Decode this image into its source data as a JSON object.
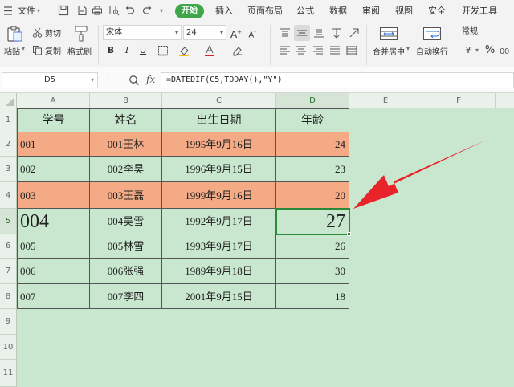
{
  "menubar": {
    "file": "文件",
    "tabs": [
      "开始",
      "插入",
      "页面布局",
      "公式",
      "数据",
      "审阅",
      "视图",
      "安全",
      "开发工具"
    ]
  },
  "ribbon": {
    "paste": "粘贴",
    "cut": "剪切",
    "copy": "复制",
    "format_painter": "格式刷",
    "font_name": "宋体",
    "font_size": "24",
    "bold": "B",
    "italic": "I",
    "underline": "U",
    "merge_center": "合并居中",
    "auto_wrap": "自动换行",
    "number_format": "常规",
    "currency": "¥",
    "percent": "%"
  },
  "formula_bar": {
    "name_box": "D5",
    "fx": "fx",
    "formula": "=DATEDIF(C5,TODAY(),\"Y\")"
  },
  "grid": {
    "columns": [
      "A",
      "B",
      "C",
      "D",
      "E",
      "F"
    ],
    "rows": [
      "1",
      "2",
      "3",
      "4",
      "5",
      "6",
      "7",
      "8",
      "9",
      "10",
      "11"
    ],
    "header": [
      "学号",
      "姓名",
      "出生日期",
      "年龄"
    ],
    "data": [
      [
        "001",
        "001王林",
        "1995年9月16日",
        "24"
      ],
      [
        "002",
        "002李昊",
        "1996年9月15日",
        "23"
      ],
      [
        "003",
        "003王磊",
        "1999年9月16日",
        "20"
      ],
      [
        "004",
        "004吴雪",
        "1992年9月17日",
        "27"
      ],
      [
        "005",
        "005林雪",
        "1993年9月17日",
        "26"
      ],
      [
        "006",
        "006张强",
        "1989年9月18日",
        "30"
      ],
      [
        "007",
        "007李四",
        "2001年9月15日",
        "18"
      ]
    ]
  },
  "colors": {
    "accent": "#3ea74a",
    "highlight_row": "#f4ab85",
    "sheet_bg": "#c9e7cf",
    "arrow": "#e8232a"
  }
}
